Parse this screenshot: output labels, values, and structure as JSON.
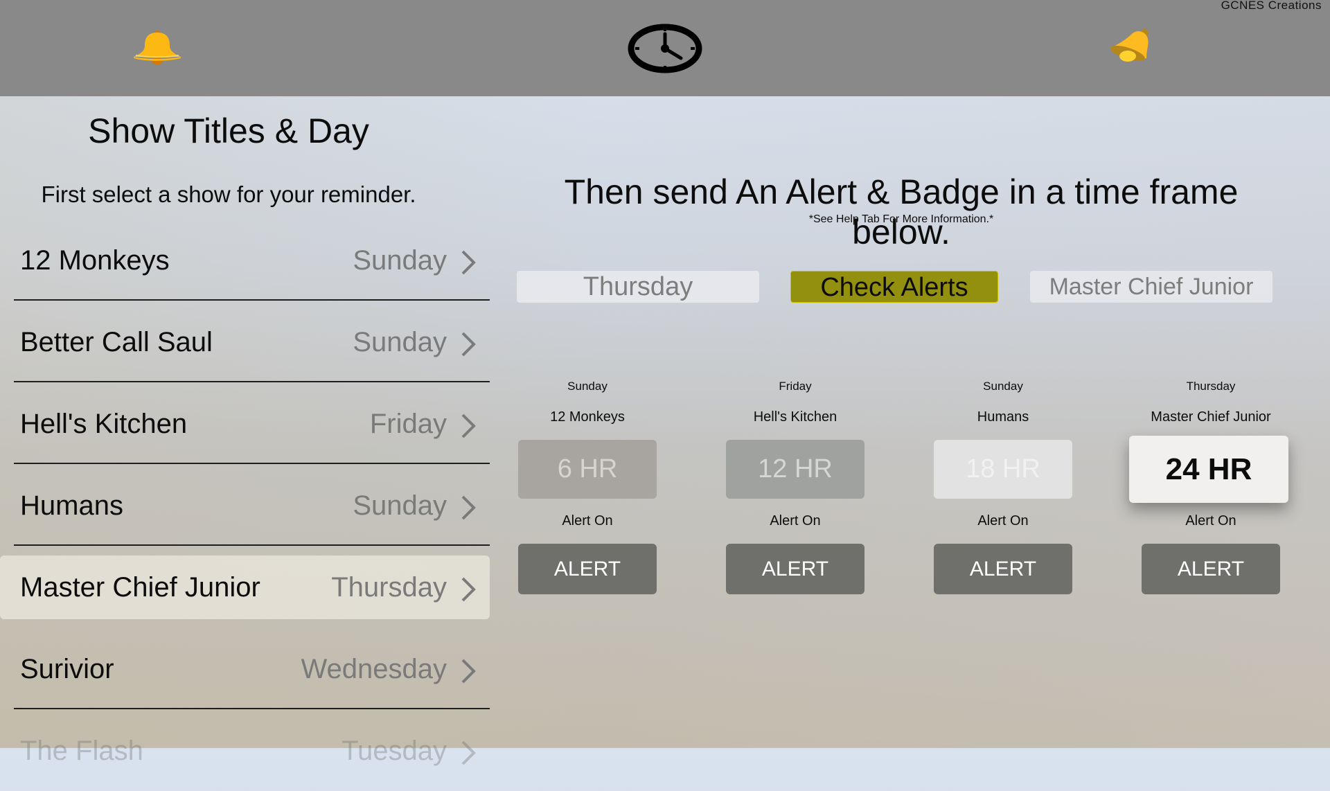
{
  "topbar": {
    "brand": "GCNES Creations",
    "icons": {
      "left": "bell-icon",
      "center": "clock-icon",
      "right": "ringing-bell-icon"
    },
    "bar_color": "#898989",
    "bell_color": "#fdb813"
  },
  "left_panel": {
    "title": "Show Titles & Day",
    "subtitle": "First select a show for your reminder.",
    "shows": [
      {
        "name": "12 Monkeys",
        "day": "Sunday"
      },
      {
        "name": "Better Call Saul",
        "day": "Sunday"
      },
      {
        "name": "Hell's Kitchen",
        "day": "Friday"
      },
      {
        "name": "Humans",
        "day": "Sunday"
      },
      {
        "name": "Master Chief Junior",
        "day": "Thursday",
        "selected": true
      },
      {
        "name": "Surivior",
        "day": "Wednesday"
      },
      {
        "name": "The Flash",
        "day": "Tuesday"
      }
    ]
  },
  "right_panel": {
    "headline": "Then send An Alert & Badge in a time frame below.",
    "note": "*See Help Tab For More Information.*",
    "selected_day": "Thursday",
    "check_alerts_label": "Check Alerts",
    "selected_show": "Master Chief Junior",
    "accent_color": "#938f0f",
    "alert_cards": [
      {
        "day": "Sunday",
        "show": "12 Monkeys",
        "timeframe": "6 HR",
        "status": "Alert On",
        "button": "ALERT"
      },
      {
        "day": "Friday",
        "show": "Hell's Kitchen",
        "timeframe": "12 HR",
        "status": "Alert On",
        "button": "ALERT"
      },
      {
        "day": "Sunday",
        "show": "Humans",
        "timeframe": "18 HR",
        "status": "Alert On",
        "button": "ALERT"
      },
      {
        "day": "Thursday",
        "show": "Master Chief Junior",
        "timeframe": "24 HR",
        "status": "Alert On",
        "button": "ALERT",
        "focused": true
      }
    ]
  }
}
